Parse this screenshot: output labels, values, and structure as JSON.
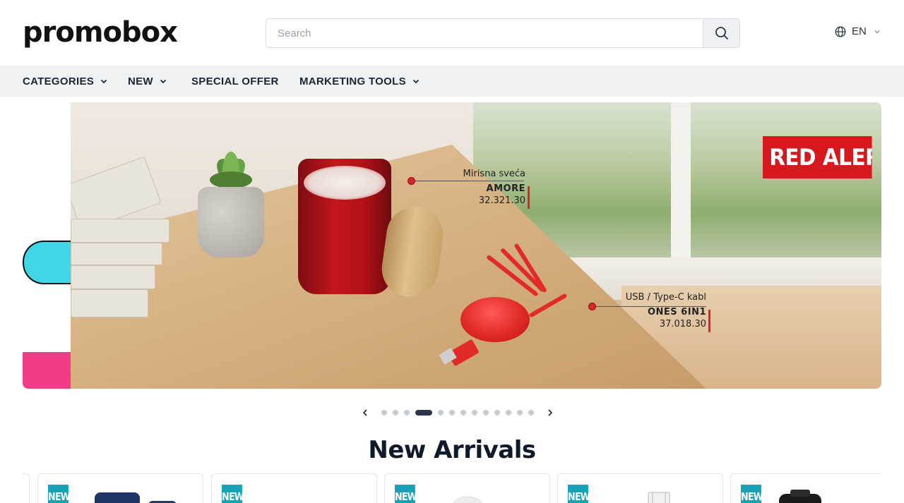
{
  "header": {
    "logo": "promobox",
    "search_placeholder": "Search",
    "language": "EN"
  },
  "nav": {
    "items": [
      {
        "label": "CATEGORIES",
        "has_dropdown": true
      },
      {
        "label": "NEW",
        "has_dropdown": true
      },
      {
        "label": "SPECIAL OFFER",
        "has_dropdown": false
      },
      {
        "label": "MARKETING TOOLS",
        "has_dropdown": true
      }
    ]
  },
  "banner": {
    "callout1": {
      "subtitle": "Mirisna sveća",
      "name": "AMORE",
      "code": "32.321.30"
    },
    "callout2": {
      "subtitle": "USB / Type-C kabl",
      "name": "ONES 6IN1",
      "code": "37.018.30"
    },
    "tag": "RED ALERT !",
    "accent_color": "#d7191f"
  },
  "carousel": {
    "total_slides": 13,
    "active_index": 3
  },
  "new_arrivals": {
    "title": "New Arrivals",
    "badge_label": "NEW",
    "badge_color": "#17a2b8"
  }
}
